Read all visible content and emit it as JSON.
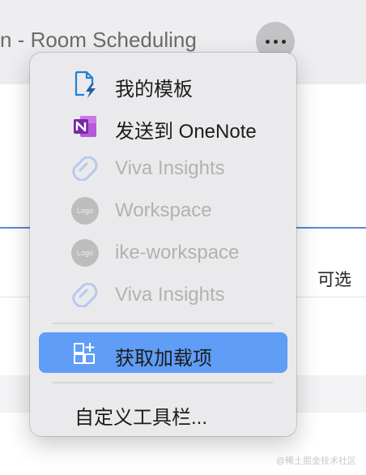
{
  "window": {
    "title": "n - Room Scheduling",
    "optional_label": "可选"
  },
  "more_button": {
    "icon": "ellipsis-icon"
  },
  "menu": {
    "items": [
      {
        "label": "我的模板",
        "icon": "template-icon",
        "enabled": true
      },
      {
        "label": "发送到 OneNote",
        "icon": "onenote-icon",
        "enabled": true
      },
      {
        "label": "Viva Insights",
        "icon": "viva-insights-icon",
        "enabled": false
      },
      {
        "label": "Workspace",
        "icon": "logo-placeholder-icon",
        "icon_text": "Logo",
        "enabled": false
      },
      {
        "label": "ike-workspace",
        "icon": "logo-placeholder-icon",
        "icon_text": "Logo",
        "enabled": false
      },
      {
        "label": "Viva Insights",
        "icon": "viva-insights-icon",
        "enabled": false
      },
      {
        "label": "获取加载项",
        "icon": "add-ins-icon",
        "enabled": true,
        "highlighted": true
      },
      {
        "label": "自定义工具栏...",
        "enabled": true
      }
    ]
  },
  "watermark": "@稀土掘金技术社区",
  "colors": {
    "highlight": "#5f9df6",
    "onenote": "#7a2aa8",
    "viva": "#b8c8ee"
  }
}
